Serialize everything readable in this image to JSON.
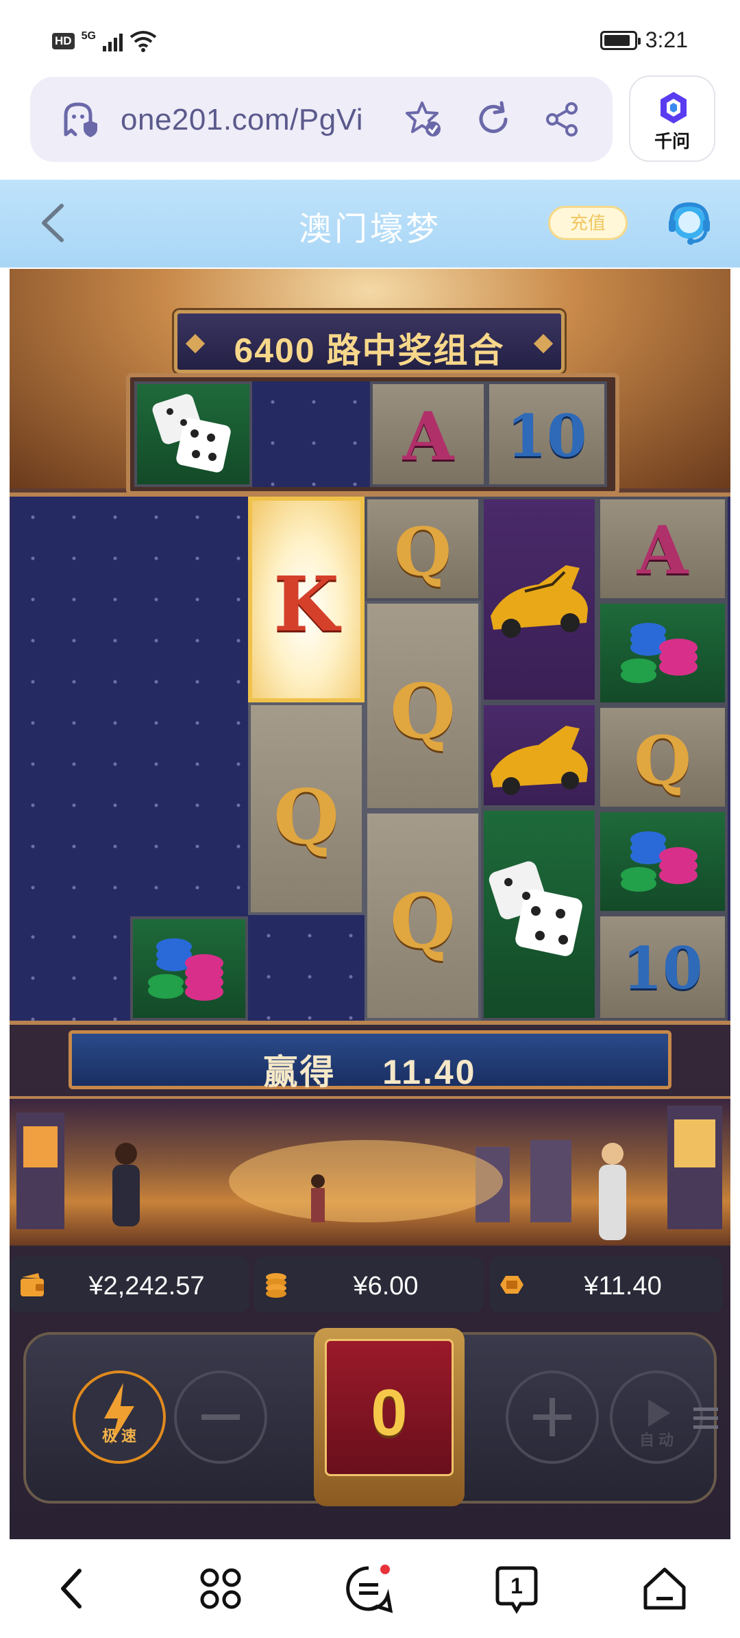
{
  "status_bar": {
    "hd": "HD",
    "network": "5G",
    "time": "3:21"
  },
  "browser": {
    "url": "one201.com/PgVi",
    "assistant_label": "千问",
    "icons": [
      "ghost-shield-icon",
      "star-check-icon",
      "refresh-icon",
      "share-icon",
      "qianwen-logo-icon"
    ]
  },
  "app_header": {
    "title": "澳门壕梦",
    "recharge_label": "充值",
    "icons": [
      "back-icon",
      "customer-support-icon"
    ]
  },
  "game": {
    "ways_banner": "6400 路中奖组合",
    "top_reel": [
      "dice",
      "empty",
      "A",
      "10"
    ],
    "reels": [
      [
        "empty",
        "empty",
        "empty",
        "chips"
      ],
      [
        "K",
        "Q",
        "empty"
      ],
      [
        "Q",
        "Q",
        "Q"
      ],
      [
        "car",
        "car",
        "dice"
      ],
      [
        "A",
        "chips",
        "Q",
        "chips",
        "10"
      ]
    ],
    "win_label": "赢得",
    "win_amount": "11.40",
    "balances": {
      "balance": "¥2,242.57",
      "bet": "¥6.00",
      "win": "¥11.40"
    },
    "controls": {
      "turbo_label": "极 速",
      "spin_value": "0",
      "auto_label": "自 动"
    },
    "colors": {
      "gold": "#f7d78a",
      "win_bar": "#1a2f62",
      "spin_red": "#8a1424"
    }
  },
  "bottom_nav": {
    "icons": [
      "nav-back-icon",
      "apps-icon",
      "menu-icon",
      "tabs-icon",
      "home-icon"
    ],
    "tabs_count": "1"
  }
}
